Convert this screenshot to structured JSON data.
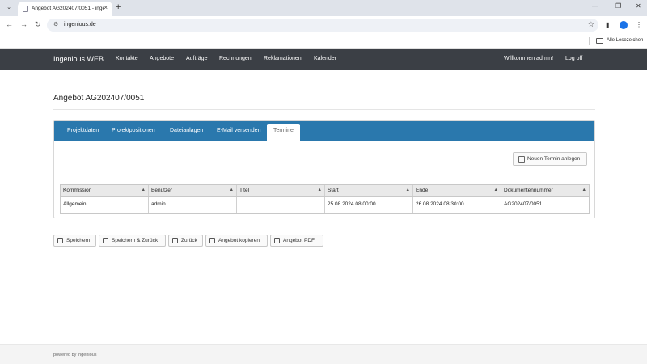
{
  "browser": {
    "tab_title": "Angebot AG202407/0051 - ingenious",
    "url": "ingenious.de",
    "bookmarks_label": "Alle Lesezeichen",
    "icons": [
      "tab-dropdown-icon",
      "favicon-icon",
      "close-icon",
      "new-tab-icon",
      "minimize-icon",
      "maximize-icon",
      "window-close-icon",
      "back-icon",
      "forward-icon",
      "reload-icon",
      "site-info-icon",
      "star-icon",
      "sidebar-icon",
      "profile-icon",
      "menu-icon",
      "folder-icon"
    ]
  },
  "navbar": {
    "brand": "Ingenious WEB",
    "items": [
      "Kontakte",
      "Angebote",
      "Aufträge",
      "Rechnungen",
      "Reklamationen",
      "Kalender"
    ],
    "welcome": "Willkommen admin!",
    "logoff": "Log off"
  },
  "page": {
    "title": "Angebot AG202407/0051"
  },
  "tabs": {
    "items": [
      "Projektdaten",
      "Projektpositionen",
      "Dateianlagen",
      "E-Mail versenden",
      "Termine"
    ],
    "active": "Termine"
  },
  "termine": {
    "new_button": "Neuen Termin anlegen",
    "columns": [
      "Kommission",
      "Benutzer",
      "Titel",
      "Start",
      "Ende",
      "Dokumentennummer"
    ],
    "rows": [
      [
        "Allgemein",
        "admin",
        "",
        "25.08.2024 08:00:00",
        "26.08.2024 08:30:00",
        "AG202407/0051"
      ]
    ]
  },
  "actions": [
    "Speichern",
    "Speichern & Zurück",
    "Zurück",
    "Angebot kopieren",
    "Angebot PDF"
  ],
  "footer": "powered by ingenious",
  "colors": {
    "navbar_bg": "#3b3f45",
    "tabs_bg": "#2a78ad"
  }
}
